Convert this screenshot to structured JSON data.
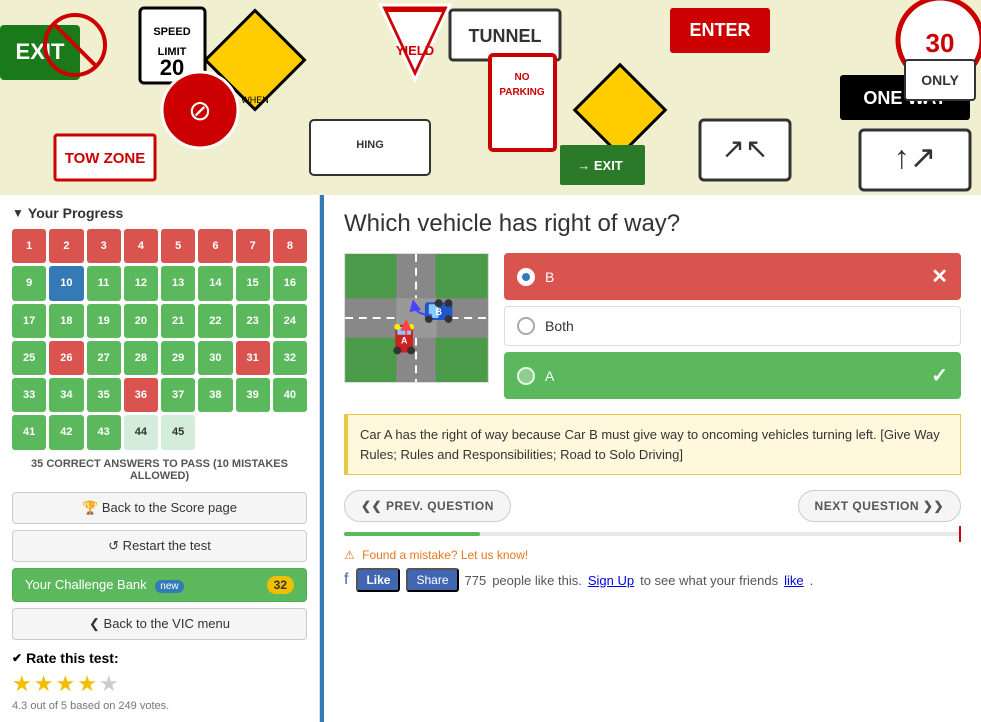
{
  "hero": {
    "alt": "Road signs collage"
  },
  "sidebar": {
    "progress_header": "Your Progress",
    "grid_cells": [
      {
        "num": 1,
        "type": "red"
      },
      {
        "num": 2,
        "type": "red"
      },
      {
        "num": 3,
        "type": "red"
      },
      {
        "num": 4,
        "type": "red"
      },
      {
        "num": 5,
        "type": "red"
      },
      {
        "num": 6,
        "type": "red"
      },
      {
        "num": 7,
        "type": "red"
      },
      {
        "num": 8,
        "type": "red"
      },
      {
        "num": 9,
        "type": "green"
      },
      {
        "num": 10,
        "type": "blue"
      },
      {
        "num": 11,
        "type": "green"
      },
      {
        "num": 12,
        "type": "green"
      },
      {
        "num": 13,
        "type": "green"
      },
      {
        "num": 14,
        "type": "green"
      },
      {
        "num": 15,
        "type": "green"
      },
      {
        "num": 16,
        "type": "green"
      },
      {
        "num": 17,
        "type": "green"
      },
      {
        "num": 18,
        "type": "green"
      },
      {
        "num": 19,
        "type": "green"
      },
      {
        "num": 20,
        "type": "green"
      },
      {
        "num": 21,
        "type": "green"
      },
      {
        "num": 22,
        "type": "green"
      },
      {
        "num": 23,
        "type": "green"
      },
      {
        "num": 24,
        "type": "green"
      },
      {
        "num": 25,
        "type": "green"
      },
      {
        "num": 26,
        "type": "red"
      },
      {
        "num": 27,
        "type": "green"
      },
      {
        "num": 28,
        "type": "green"
      },
      {
        "num": 29,
        "type": "green"
      },
      {
        "num": 30,
        "type": "green"
      },
      {
        "num": 31,
        "type": "red"
      },
      {
        "num": 32,
        "type": "green"
      },
      {
        "num": 33,
        "type": "green"
      },
      {
        "num": 34,
        "type": "green"
      },
      {
        "num": 35,
        "type": "green"
      },
      {
        "num": 36,
        "type": "red"
      },
      {
        "num": 37,
        "type": "green"
      },
      {
        "num": 38,
        "type": "green"
      },
      {
        "num": 39,
        "type": "green"
      },
      {
        "num": 40,
        "type": "green"
      },
      {
        "num": 41,
        "type": "green"
      },
      {
        "num": 42,
        "type": "green"
      },
      {
        "num": 43,
        "type": "green"
      },
      {
        "num": 44,
        "type": "light"
      },
      {
        "num": 45,
        "type": "light"
      }
    ],
    "pass_info": "35 CORRECT ANSWERS TO PASS (10 MISTAKES ALLOWED)",
    "btn_score": "🏆 Back to the Score page",
    "btn_restart": "↺ Restart the test",
    "btn_challenge_label": "Your Challenge Bank",
    "btn_challenge_new": "new",
    "btn_challenge_count": "32",
    "btn_vic": "❮ Back to the VIC menu",
    "rate_header": "Rate this test:",
    "stars": [
      true,
      true,
      true,
      true,
      false
    ],
    "rating_text": "4.3 out of 5 based on 249 votes."
  },
  "content": {
    "question": "Which vehicle has right of way?",
    "options": [
      {
        "label": "B",
        "state": "wrong",
        "has_dot": true
      },
      {
        "label": "Both",
        "state": "neutral",
        "has_dot": false
      },
      {
        "label": "A",
        "state": "correct",
        "has_dot": false
      }
    ],
    "explanation": "Car A has the right of way because Car B must give way to oncoming vehicles turning left. [Give Way Rules; Rules and Responsibilities; Road to Solo Driving]",
    "prev_btn": "❮❮ PREV. QUESTION",
    "next_btn": "NEXT QUESTION ❯❯",
    "progress_percent": 22,
    "mistake_text": "Found a mistake? Let us know!",
    "fb_count": "775",
    "fb_text1": "people like this.",
    "fb_signup": "Sign Up",
    "fb_text2": "to see what your friends",
    "fb_like_word": "like",
    "like_label": "Like",
    "share_label": "Share"
  }
}
